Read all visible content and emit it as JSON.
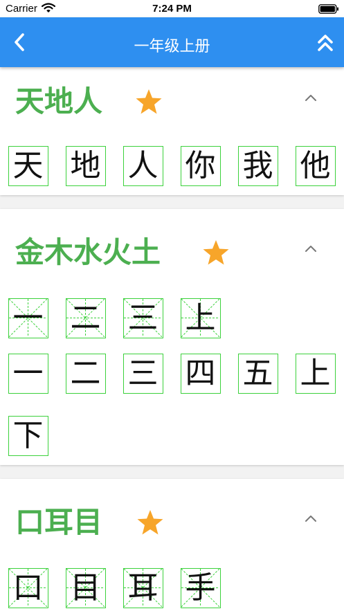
{
  "status_bar": {
    "carrier": "Carrier",
    "time": "7:24 PM",
    "wifi_icon": "wifi-icon",
    "battery_icon": "battery-icon"
  },
  "nav": {
    "title": "一年级上册",
    "back_icon": "chevron-left-icon",
    "collapse_icon": "double-chevron-up-icon",
    "background": "#2e8ff0"
  },
  "colors": {
    "title_green": "#4caf50",
    "grid_green": "#3bd13b",
    "star_orange": "#f7a52a"
  },
  "sections": [
    {
      "title": "天地人",
      "starred": true,
      "rows": [
        {
          "grid": false,
          "chars": [
            "天",
            "地",
            "人",
            "你",
            "我",
            "他"
          ]
        }
      ]
    },
    {
      "title": "金木水火土",
      "starred": true,
      "rows": [
        {
          "grid": true,
          "chars": [
            "一",
            "二",
            "三",
            "上"
          ]
        },
        {
          "grid": false,
          "chars": [
            "一",
            "二",
            "三",
            "四",
            "五",
            "上"
          ]
        },
        {
          "grid": false,
          "chars": [
            "下"
          ]
        }
      ]
    },
    {
      "title": "口耳目",
      "starred": true,
      "rows": [
        {
          "grid": true,
          "chars": [
            "口",
            "目",
            "耳",
            "手"
          ]
        }
      ]
    }
  ]
}
